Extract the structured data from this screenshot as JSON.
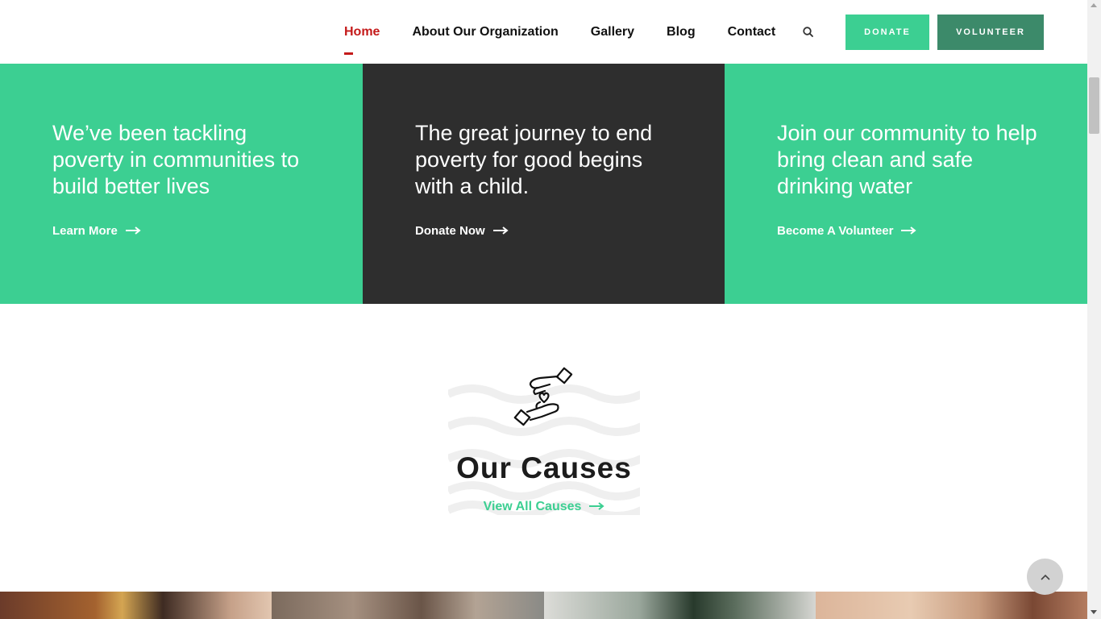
{
  "nav": {
    "items": [
      {
        "label": "Home",
        "active": true
      },
      {
        "label": "About Our Organization",
        "active": false
      },
      {
        "label": "Gallery",
        "active": false
      },
      {
        "label": "Blog",
        "active": false
      },
      {
        "label": "Contact",
        "active": false
      }
    ],
    "search_icon": "search-icon",
    "donate_label": "DONATE",
    "volunteer_label": "VOLUNTEER"
  },
  "hero": {
    "panels": [
      {
        "title": "We’ve been tackling poverty in communities to build better lives",
        "link": "Learn More",
        "color": "#3ccf92"
      },
      {
        "title": "The great journey to end poverty for good begins with a child.",
        "link": "Donate Now",
        "color": "#2e2e2e"
      },
      {
        "title": "Join our community to help bring clean and safe drinking water",
        "link": "Become A Volunteer",
        "color": "#3ccf92"
      }
    ]
  },
  "causes": {
    "title": "Our Causes",
    "link": "View All Causes",
    "icon": "hands-heart-icon"
  },
  "colors": {
    "accent_green": "#3ccf92",
    "dark_green": "#3c8a6a",
    "active_red": "#c41a1a",
    "dark_panel": "#2e2e2e"
  }
}
